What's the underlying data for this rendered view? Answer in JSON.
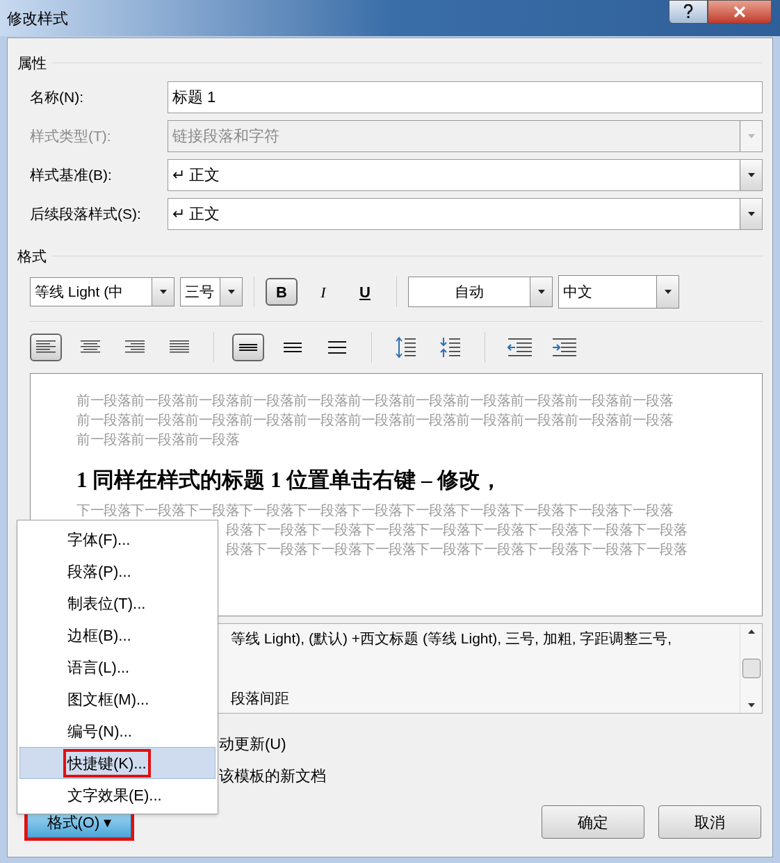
{
  "window": {
    "title": "修改样式"
  },
  "properties": {
    "heading": "属性",
    "rows": [
      {
        "kind": "input",
        "label": "名称(N):",
        "value": "标题 1",
        "disabled": false
      },
      {
        "kind": "select",
        "label": "样式类型(T):",
        "value": "链接段落和字符",
        "disabled": true
      },
      {
        "kind": "select",
        "label": "样式基准(B):",
        "value": "↵ 正文",
        "disabled": false
      },
      {
        "kind": "select",
        "label": "后续段落样式(S):",
        "value": "↵ 正文",
        "disabled": false
      }
    ]
  },
  "format": {
    "heading": "格式",
    "font": "等线 Light (中",
    "size": "三号",
    "toggles": [
      {
        "label": "B",
        "kind": "bold",
        "selected": true
      },
      {
        "label": "I",
        "kind": "italic",
        "selected": false
      },
      {
        "label": "U",
        "kind": "underline",
        "selected": false
      }
    ],
    "font_color": "自动",
    "language": "中文",
    "alignment": [
      {
        "kind": "left",
        "selected": true
      },
      {
        "kind": "center",
        "selected": false
      },
      {
        "kind": "right",
        "selected": false
      },
      {
        "kind": "justify",
        "selected": false
      }
    ],
    "line_spacing": [
      {
        "kind": "single",
        "selected": true
      },
      {
        "kind": "one-half",
        "selected": false
      },
      {
        "kind": "double",
        "selected": false
      }
    ]
  },
  "preview": {
    "before": [
      "前一段落前一段落前一段落前一段落前一段落前一段落前一段落前一段落前一段落前一段落前一段落",
      "前一段落前一段落前一段落前一段落前一段落前一段落前一段落前一段落前一段落前一段落前一段落",
      "前一段落前一段落前一段落"
    ],
    "heading": "1  同样在样式的标题 1 位置单击右键 – 修改，",
    "after": [
      "下一段落下一段落下一段落下一段落下一段落下一段落下一段落下一段落下一段落下一段落下一段落",
      "段落下一段落下一段落下一段落下一段落下一段落下一段落下一段落下一段落",
      "段落下一段落下一段落下一段落下一段落下一段落下一段落下一段落下一段落"
    ]
  },
  "description": [
    "等线 Light), (默认) +西文标题 (等线 Light), 三号, 加粗, 字距调整三号,",
    "段落间距"
  ],
  "options": [
    "动更新(U)",
    "该模板的新文档"
  ],
  "menu": [
    {
      "label": "字体(F)...",
      "selected": false,
      "marked": false
    },
    {
      "label": "段落(P)...",
      "selected": false,
      "marked": false
    },
    {
      "label": "制表位(T)...",
      "selected": false,
      "marked": false
    },
    {
      "label": "边框(B)...",
      "selected": false,
      "marked": false
    },
    {
      "label": "语言(L)...",
      "selected": false,
      "marked": false
    },
    {
      "label": "图文框(M)...",
      "selected": false,
      "marked": false
    },
    {
      "label": "编号(N)...",
      "selected": false,
      "marked": false
    },
    {
      "label": "快捷键(K)...",
      "selected": true,
      "marked": true
    },
    {
      "label": "文字效果(E)...",
      "selected": false,
      "marked": false
    }
  ],
  "buttons": {
    "format": {
      "label": "格式(O) ▾",
      "marked": true
    },
    "ok": "确定",
    "cancel": "取消"
  }
}
